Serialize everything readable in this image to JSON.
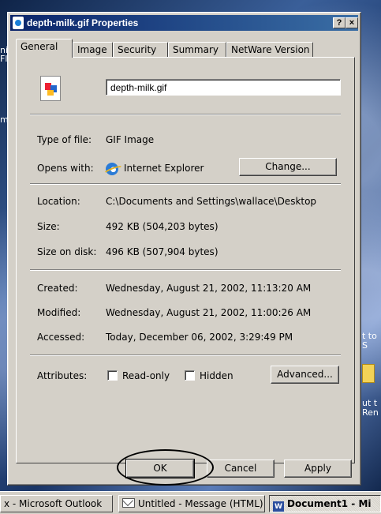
{
  "window": {
    "title": "depth-milk.gif Properties",
    "help_label": "?",
    "close_label": "×"
  },
  "tabs": [
    {
      "label": "General"
    },
    {
      "label": "Image"
    },
    {
      "label": "Security"
    },
    {
      "label": "Summary"
    },
    {
      "label": "NetWare Version"
    }
  ],
  "general": {
    "file_name": "depth-milk.gif",
    "type_label": "Type of file:",
    "type_value": "GIF Image",
    "opens_label": "Opens with:",
    "opens_value": "Internet Explorer",
    "change_button": "Change...",
    "location_label": "Location:",
    "location_value": "C:\\Documents and Settings\\wallace\\Desktop",
    "size_label": "Size:",
    "size_value": "492 KB (504,203 bytes)",
    "size_disk_label": "Size on disk:",
    "size_disk_value": "496 KB (507,904 bytes)",
    "created_label": "Created:",
    "created_value": "Wednesday, August 21, 2002, 11:13:20 AM",
    "modified_label": "Modified:",
    "modified_value": "Wednesday, August 21, 2002, 11:00:26 AM",
    "accessed_label": "Accessed:",
    "accessed_value": "Today, December 06, 2002, 3:29:49 PM",
    "attributes_label": "Attributes:",
    "readonly_label": "Read-only",
    "hidden_label": "Hidden",
    "advanced_button": "Advanced..."
  },
  "buttons": {
    "ok": "OK",
    "cancel": "Cancel",
    "apply": "Apply"
  },
  "taskbar": {
    "outlook": "x - Microsoft Outlook",
    "message": "Untitled - Message (HTML)",
    "document": "Document1 - Mi"
  },
  "desktop_fragments": {
    "left": [
      "ni",
      "Fl",
      "m"
    ],
    "right": [
      "t to",
      "S",
      "ut t",
      "Ren"
    ]
  }
}
